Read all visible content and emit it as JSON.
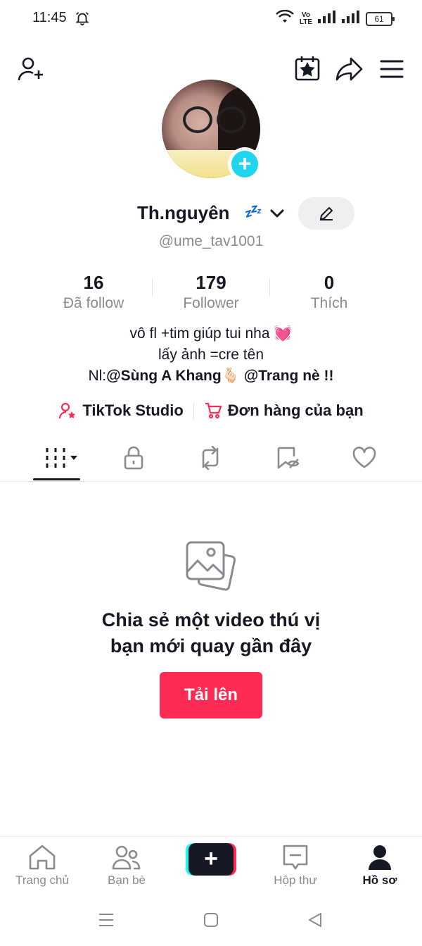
{
  "status_bar": {
    "time": "11:45",
    "volte_top": "Vo",
    "volte_bottom": "LTE",
    "battery": "61"
  },
  "top_bar": {
    "add_friend_icon": "person-add-icon",
    "calendar_icon": "calendar-star-icon",
    "share_icon": "share-arrow-icon",
    "menu_icon": "hamburger-menu-icon"
  },
  "profile": {
    "name": "Th.nguyên",
    "name_emoji": "💤",
    "handle": "@ume_tav1001",
    "add_avatar_symbol": "+",
    "edit_icon": "pencil-icon"
  },
  "stats": [
    {
      "value": "16",
      "label": "Đã follow"
    },
    {
      "value": "179",
      "label": "Follower"
    },
    {
      "value": "0",
      "label": "Thích"
    }
  ],
  "bio": {
    "line1": "vô fl +tim giúp tui nha 💓",
    "line2": "lấy ảnh =cre tên",
    "line3_prefix": "Nl:",
    "line3_mention1": "@Sùng A Khang",
    "line3_emoji": "🫰🏻",
    "line3_mention2": "@Trang nè !!"
  },
  "links": {
    "studio": "TikTok Studio",
    "orders": "Đơn hàng của bạn"
  },
  "tabs": [
    {
      "name": "videos-grid",
      "active": true
    },
    {
      "name": "private",
      "active": false
    },
    {
      "name": "reposts",
      "active": false
    },
    {
      "name": "favorites-hidden",
      "active": false
    },
    {
      "name": "liked",
      "active": false
    }
  ],
  "empty_state": {
    "title_line1": "Chia sẻ một video thú vị",
    "title_line2": "bạn mới quay gần đây",
    "button": "Tải lên"
  },
  "bottom_nav": [
    {
      "label": "Trang chủ",
      "icon": "home-icon",
      "active": false
    },
    {
      "label": "Bạn bè",
      "icon": "friends-icon",
      "active": false
    },
    {
      "label": "",
      "icon": "create-plus-icon",
      "active": false
    },
    {
      "label": "Hộp thư",
      "icon": "inbox-icon",
      "active": false
    },
    {
      "label": "Hồ sơ",
      "icon": "profile-icon",
      "active": true
    }
  ],
  "colors": {
    "accent": "#fe2c55",
    "cyan": "#25f4ee",
    "avatar_plus": "#20d5ec",
    "text": "#161823",
    "muted": "#8a8b91"
  }
}
